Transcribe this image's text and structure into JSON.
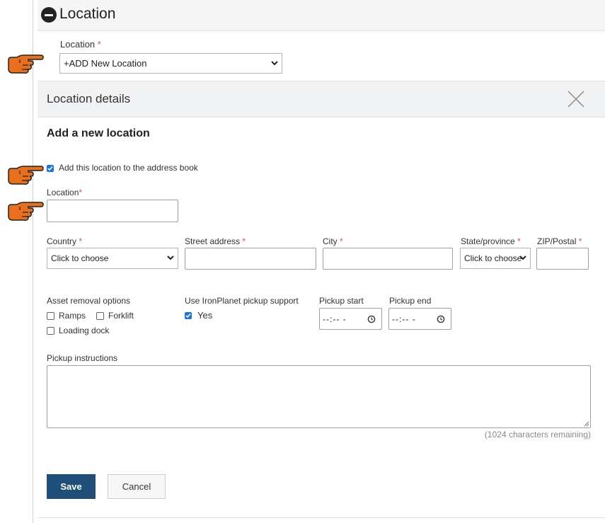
{
  "section": {
    "title": "Location",
    "icon": "minus-circle-icon"
  },
  "location_select": {
    "label": "Location",
    "required_mark": "*",
    "value": "+ADD New Location"
  },
  "panel": {
    "title": "Location details",
    "close_icon": "close-icon"
  },
  "form": {
    "heading": "Add a new location",
    "address_book_checkbox": {
      "label": "Add this location to the address book",
      "checked": true
    },
    "location_name": {
      "label": "Location",
      "required_mark": "*",
      "value": ""
    },
    "country": {
      "label": "Country",
      "required_mark": "*",
      "value": "Click to choose"
    },
    "street": {
      "label": "Street address",
      "required_mark": "*",
      "value": ""
    },
    "city": {
      "label": "City",
      "required_mark": "*",
      "value": ""
    },
    "state": {
      "label": "State/province",
      "required_mark": "*",
      "value": "Click to choose"
    },
    "zip": {
      "label": "ZIP/Postal",
      "required_mark": "*",
      "value": ""
    },
    "asset_removal": {
      "label": "Asset removal options",
      "options": [
        {
          "label": "Ramps",
          "checked": false
        },
        {
          "label": "Forklift",
          "checked": false
        },
        {
          "label": "Loading dock",
          "checked": false
        }
      ]
    },
    "pickup_support": {
      "label": "Use IronPlanet pickup support",
      "option_label": "Yes",
      "checked": true
    },
    "pickup_start": {
      "label": "Pickup start",
      "value": "--:-- -"
    },
    "pickup_end": {
      "label": "Pickup end",
      "value": "--:-- -"
    },
    "instructions": {
      "label": "Pickup instructions",
      "value": "",
      "remaining": "(1024 characters remaining)"
    },
    "save_label": "Save",
    "cancel_label": "Cancel"
  },
  "colors": {
    "accent": "#1f4e79",
    "checkbox": "#1a73e8",
    "required": "#d9534f",
    "pointer_hand": "#e8701c"
  }
}
